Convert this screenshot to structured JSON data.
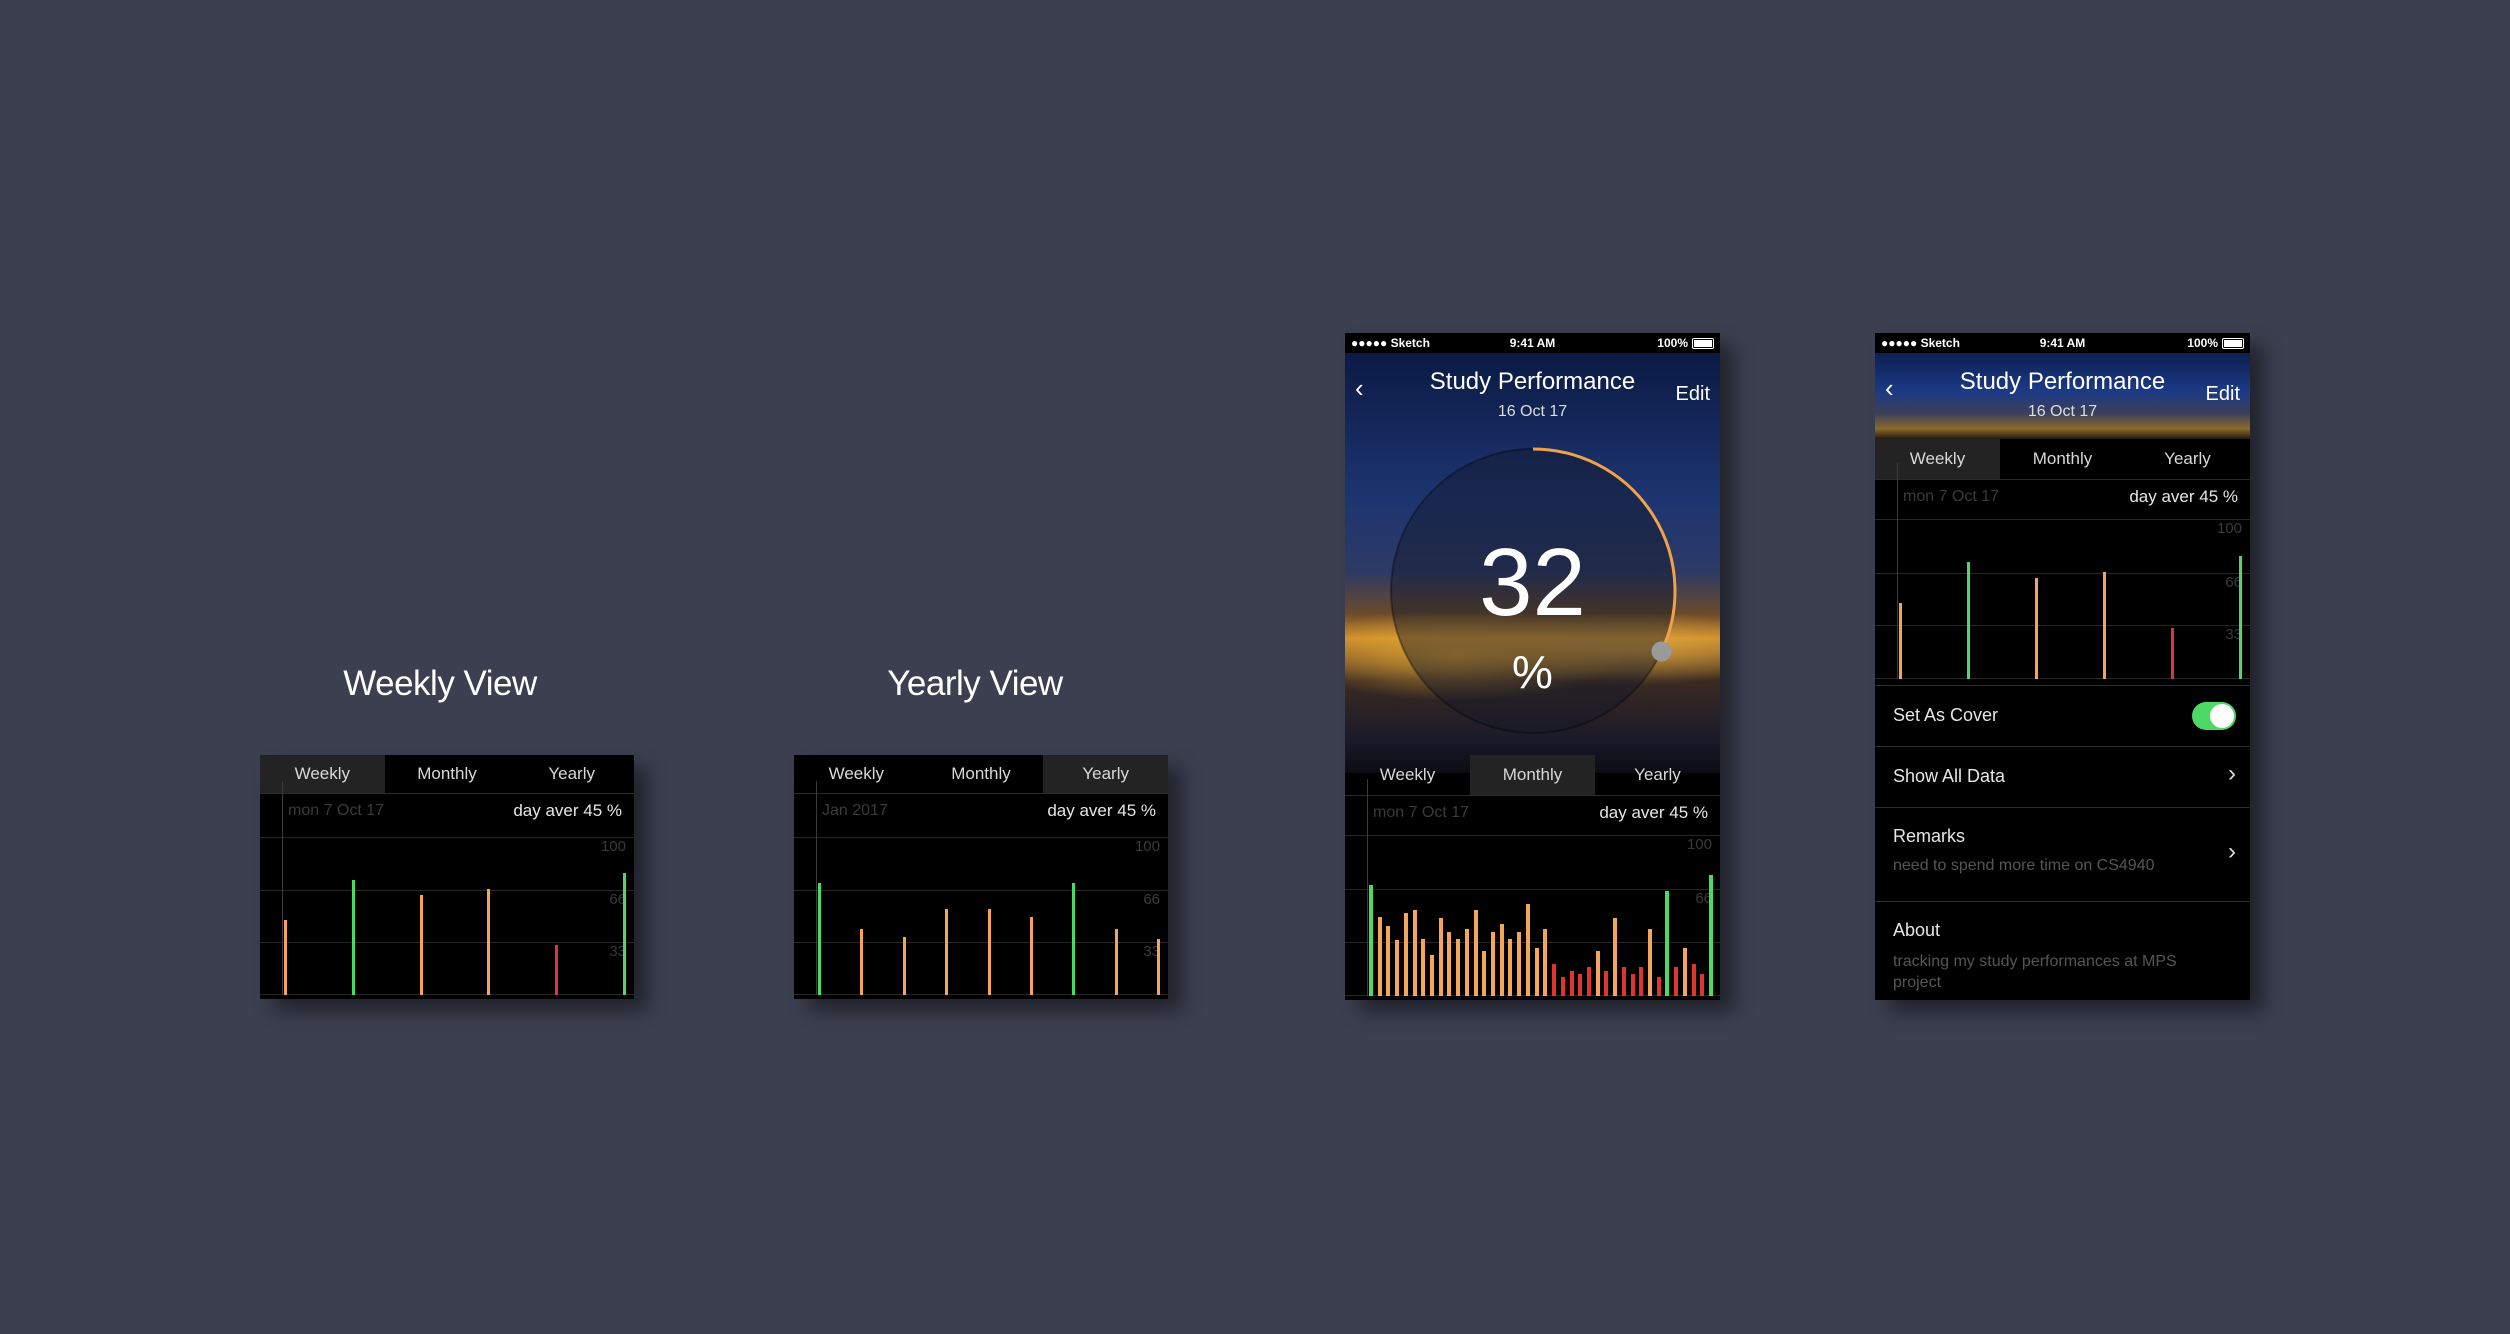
{
  "colors": {
    "background": "#3c3f50",
    "green": "#4cd964",
    "orange": "#f5a55a",
    "red": "#e0342e",
    "ring": "#f0a24a"
  },
  "tabs": [
    "Weekly",
    "Monthly",
    "Yearly"
  ],
  "weekly_view": {
    "caption": "Weekly View",
    "active_tab": 0,
    "date_label": "mon 7 Oct 17",
    "avg_label": "day aver 45 %",
    "grid_labels": [
      "100",
      "66",
      "33"
    ],
    "bars": [
      {
        "value": 48,
        "color": "orange"
      },
      {
        "value": 74,
        "color": "green"
      },
      {
        "value": 64,
        "color": "orange"
      },
      {
        "value": 68,
        "color": "orange"
      },
      {
        "value": 32,
        "color": "red"
      },
      {
        "value": 78,
        "color": "green"
      }
    ]
  },
  "yearly_view": {
    "caption": "Yearly View",
    "active_tab": 2,
    "date_label": "Jan 2017",
    "avg_label": "day aver 45 %",
    "grid_labels": [
      "100",
      "66",
      "33"
    ],
    "bars": [
      {
        "value": 72,
        "color": "green"
      },
      {
        "value": 42,
        "color": "orange"
      },
      {
        "value": 37,
        "color": "orange"
      },
      {
        "value": 55,
        "color": "orange"
      },
      {
        "value": 55,
        "color": "orange"
      },
      {
        "value": 50,
        "color": "orange"
      },
      {
        "value": 72,
        "color": "green"
      },
      {
        "value": 42,
        "color": "orange"
      },
      {
        "value": 36,
        "color": "orange"
      }
    ]
  },
  "status_bar": {
    "carrier": "●●●●● Sketch",
    "time": "9:41 AM",
    "battery": "100%"
  },
  "phone1": {
    "title": "Study Performance",
    "date": "16 Oct 17",
    "edit": "Edit",
    "percent_value": "32",
    "percent_sign": "%",
    "progress": 0.32,
    "active_tab": 1,
    "date_label": "mon 7 Oct 17",
    "avg_label": "day aver 45 %",
    "grid_labels": [
      "100",
      "66"
    ],
    "bars": [
      {
        "value": 70,
        "color": "green"
      },
      {
        "value": 50,
        "color": "orange"
      },
      {
        "value": 44,
        "color": "orange"
      },
      {
        "value": 35,
        "color": "orange"
      },
      {
        "value": 52,
        "color": "orange"
      },
      {
        "value": 54,
        "color": "orange"
      },
      {
        "value": 36,
        "color": "orange"
      },
      {
        "value": 26,
        "color": "orange"
      },
      {
        "value": 49,
        "color": "orange"
      },
      {
        "value": 40,
        "color": "orange"
      },
      {
        "value": 36,
        "color": "orange"
      },
      {
        "value": 42,
        "color": "orange"
      },
      {
        "value": 54,
        "color": "orange"
      },
      {
        "value": 28,
        "color": "orange"
      },
      {
        "value": 40,
        "color": "orange"
      },
      {
        "value": 45,
        "color": "orange"
      },
      {
        "value": 36,
        "color": "orange"
      },
      {
        "value": 40,
        "color": "orange"
      },
      {
        "value": 58,
        "color": "orange"
      },
      {
        "value": 30,
        "color": "orange"
      },
      {
        "value": 42,
        "color": "orange"
      },
      {
        "value": 20,
        "color": "red"
      },
      {
        "value": 12,
        "color": "red"
      },
      {
        "value": 16,
        "color": "red"
      },
      {
        "value": 14,
        "color": "red"
      },
      {
        "value": 18,
        "color": "red"
      },
      {
        "value": 28,
        "color": "orange"
      },
      {
        "value": 16,
        "color": "red"
      },
      {
        "value": 49,
        "color": "orange"
      },
      {
        "value": 18,
        "color": "red"
      },
      {
        "value": 14,
        "color": "red"
      },
      {
        "value": 18,
        "color": "red"
      },
      {
        "value": 42,
        "color": "orange"
      },
      {
        "value": 12,
        "color": "red"
      },
      {
        "value": 66,
        "color": "green"
      },
      {
        "value": 18,
        "color": "red"
      },
      {
        "value": 30,
        "color": "orange"
      },
      {
        "value": 20,
        "color": "red"
      },
      {
        "value": 14,
        "color": "red"
      },
      {
        "value": 76,
        "color": "green"
      }
    ]
  },
  "phone2": {
    "title": "Study Performance",
    "date": "16 Oct 17",
    "edit": "Edit",
    "active_tab": 0,
    "date_label": "mon 7 Oct 17",
    "avg_label": "day aver 45 %",
    "grid_labels": [
      "100",
      "66",
      "33"
    ],
    "bars": [
      {
        "value": 48,
        "color": "orange"
      },
      {
        "value": 74,
        "color": "green"
      },
      {
        "value": 64,
        "color": "orange"
      },
      {
        "value": 68,
        "color": "orange"
      },
      {
        "value": 32,
        "color": "red"
      },
      {
        "value": 78,
        "color": "green"
      }
    ],
    "set_as_cover": "Set As Cover",
    "set_as_cover_on": true,
    "show_all_data": "Show All Data",
    "remarks_title": "Remarks",
    "remarks_text": "need to spend more time on CS4940",
    "about_title": "About",
    "about_text": "tracking my study performances at MPS project"
  }
}
